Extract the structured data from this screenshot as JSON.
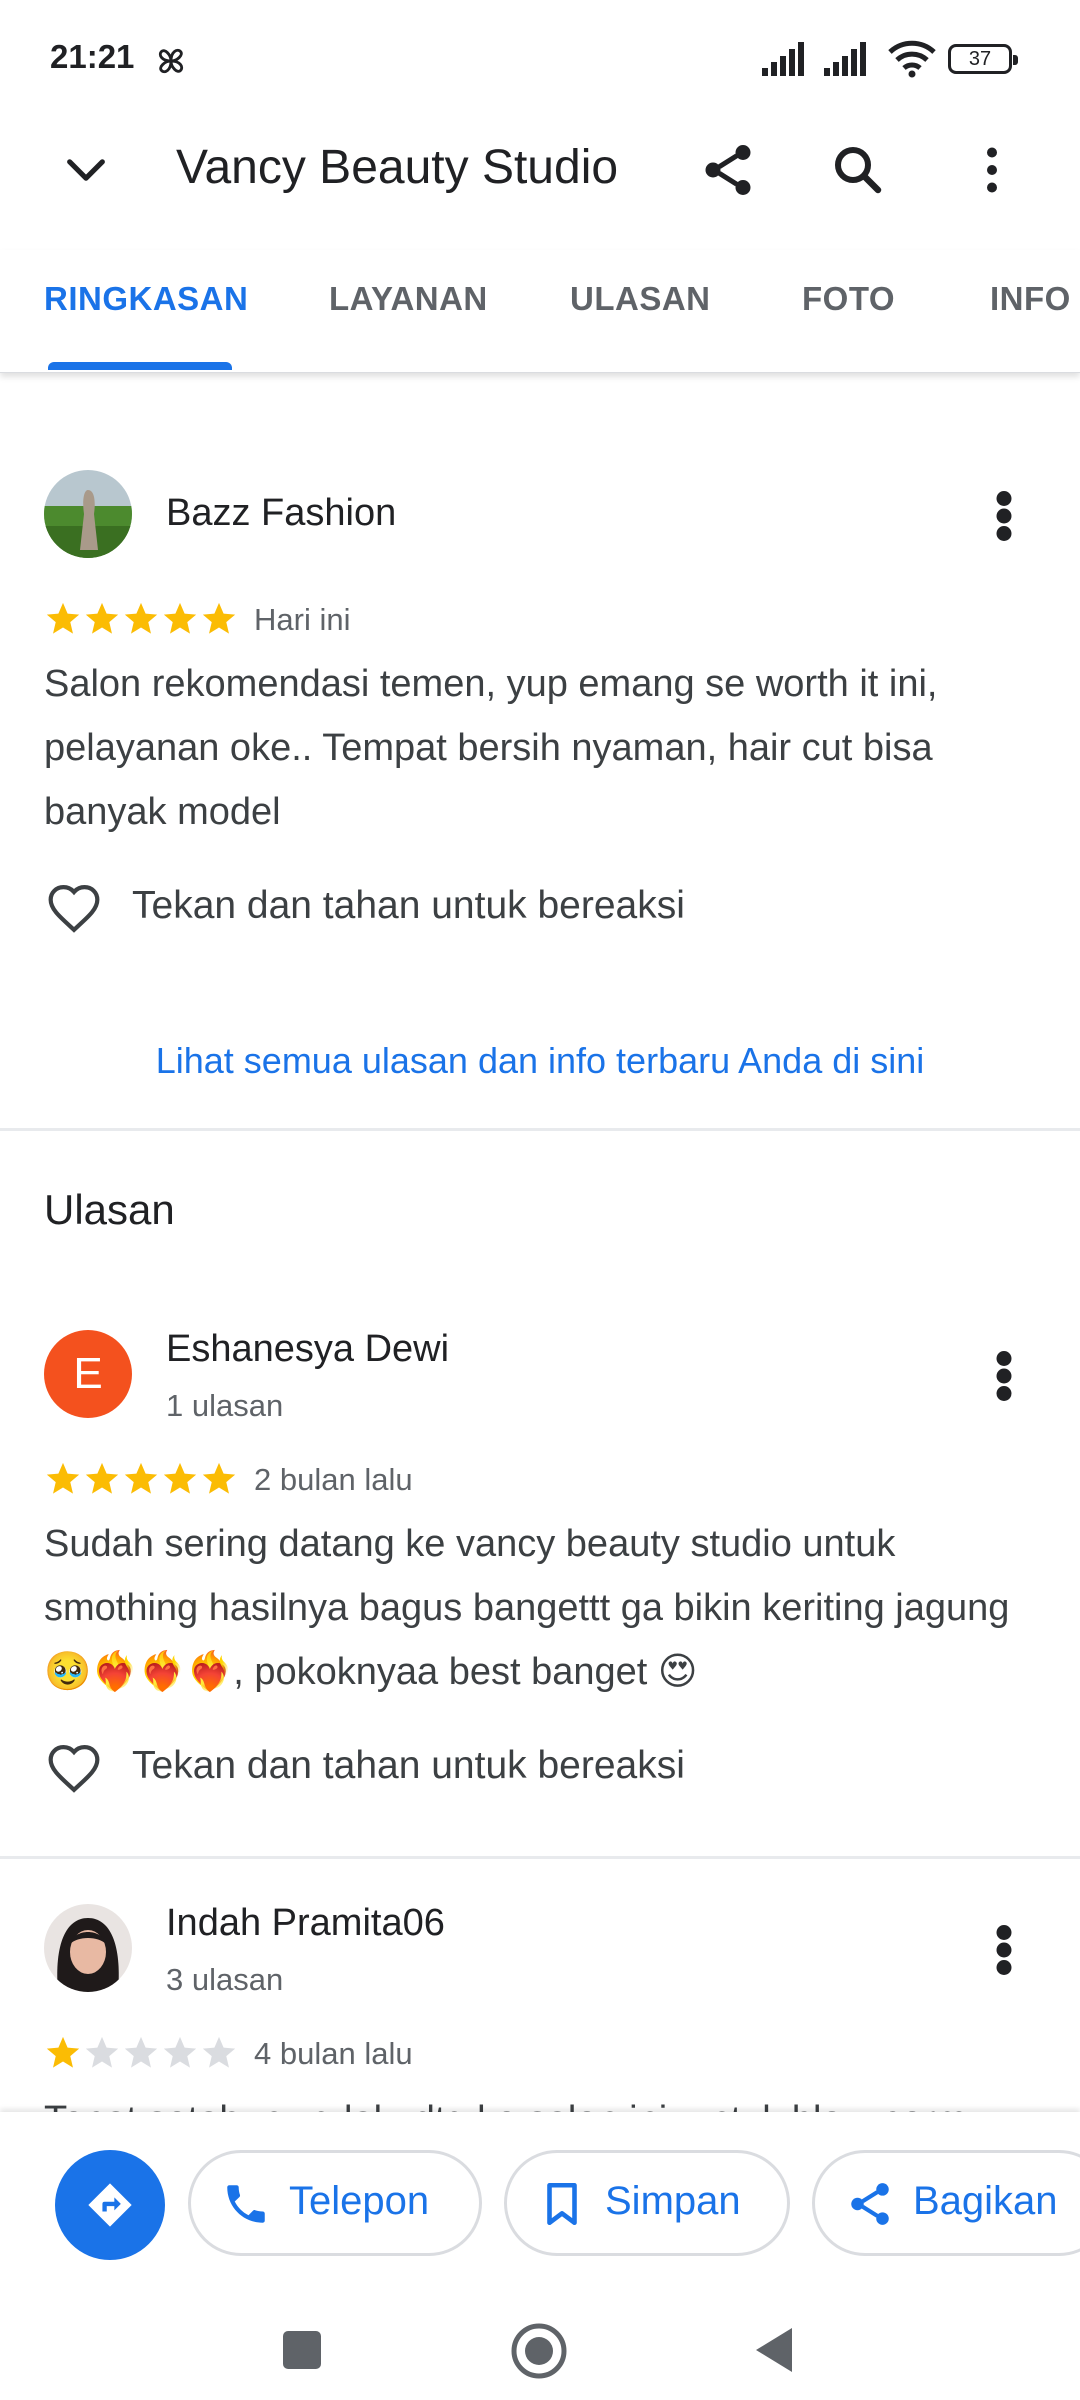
{
  "status_bar": {
    "time": "21:21",
    "battery": "37"
  },
  "app_bar": {
    "title": "Vancy Beauty Studio"
  },
  "tabs": [
    {
      "label": "RINGKASAN",
      "active": true
    },
    {
      "label": "LAYANAN"
    },
    {
      "label": "ULASAN"
    },
    {
      "label": "FOTO"
    },
    {
      "label": "INFO"
    }
  ],
  "own_review": {
    "name": "Bazz Fashion",
    "rating": 5,
    "date": "Hari ini",
    "text": "Salon rekomendasi temen, yup emang se worth it ini, pelayanan oke.. Tempat bersih nyaman, hair cut bisa banyak model",
    "react_label": "Tekan dan tahan untuk bereaksi"
  },
  "see_all_link": "Lihat semua ulasan dan info terbaru Anda di sini",
  "reviews_section": {
    "title": "Ulasan",
    "items": [
      {
        "avatar_letter": "E",
        "name": "Eshanesya Dewi",
        "count": "1 ulasan",
        "rating": 5,
        "date": "2 bulan lalu",
        "text": "Sudah sering datang ke vancy beauty studio untuk smothing hasilnya bagus bangettt ga bikin keriting jagung 🥹❤️‍🔥❤️‍🔥❤️‍🔥, pokoknyaa best banget 😍",
        "react_label": "Tekan dan tahan untuk bereaksi"
      },
      {
        "name": "Indah Pramita06",
        "count": "3 ulasan",
        "rating": 1,
        "date": "4 bulan lalu",
        "text": "Tepat setahun yg lalu dtg ke salon ini, untuk blow perm"
      }
    ]
  },
  "actions": {
    "call": "Telepon",
    "save": "Simpan",
    "share": "Bagikan"
  },
  "colors": {
    "accent": "#1a73e8",
    "star": "#fbbc04",
    "star_empty": "#dadce0",
    "letter_avatar": "#f4511e"
  }
}
